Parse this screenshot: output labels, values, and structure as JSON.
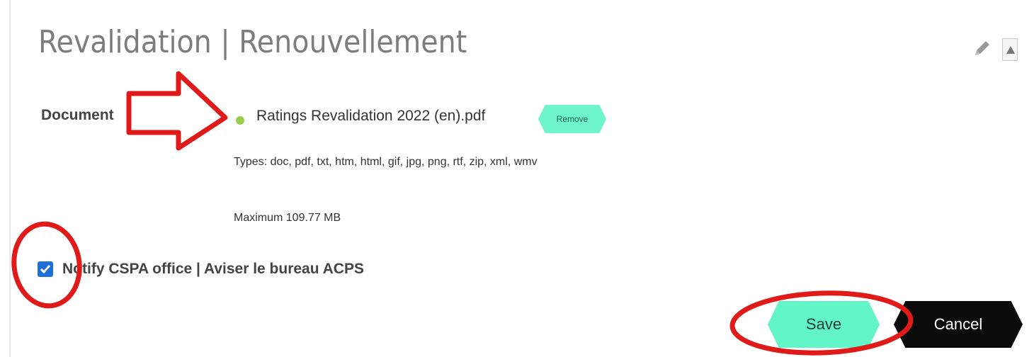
{
  "section": {
    "title": "Revalidation | Renouvellement",
    "edit_icon": "pencil-icon",
    "collapse_icon": "triangle-up-icon"
  },
  "document": {
    "label": "Document",
    "status_color": "#9bcc4e",
    "file_name": "Ratings Revalidation 2022 (en).pdf",
    "remove_label": "Remove",
    "types_text": "Types: doc, pdf, txt, htm, html, gif, jpg, png, rtf, zip, xml, wmv",
    "max_text": "Maximum 109.77 MB"
  },
  "notify": {
    "checked": true,
    "label": "Notify CSPA office | Aviser le bureau ACPS"
  },
  "actions": {
    "save_label": "Save",
    "cancel_label": "Cancel"
  },
  "colors": {
    "accent": "#62f5c8",
    "cancel_bg": "#0b0b0b",
    "annotation": "#e01919",
    "checkbox": "#1f6fd8"
  },
  "annotations": [
    "red-arrow",
    "red-circle-checkbox",
    "red-circle-save"
  ]
}
